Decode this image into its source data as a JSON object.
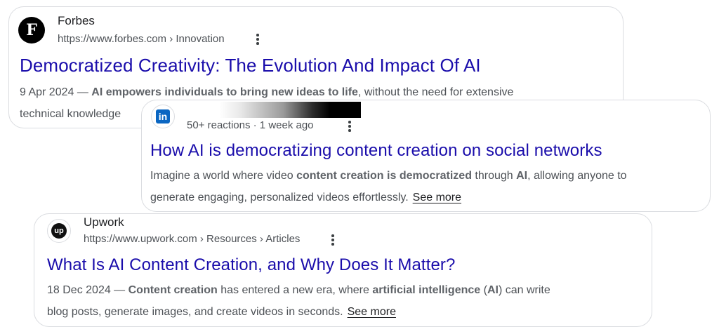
{
  "results": {
    "forbes": {
      "site_name": "Forbes",
      "url": "https://www.forbes.com › Innovation",
      "favicon_letter": "F",
      "title": "Democratized Creativity: The Evolution And Impact Of AI",
      "date": "9 Apr 2024",
      "dash": " — ",
      "snippet_bold": "AI empowers individuals to bring new ideas to life",
      "snippet_rest": ", without the need for extensive",
      "snippet_line2": "technical knowledge"
    },
    "linkedin": {
      "favicon_text": "in",
      "meta": "50+ reactions · 1 week ago",
      "title": "How AI is democratizing content creation on social networks",
      "s1": "Imagine a world where video ",
      "s2": "content creation",
      "s3": " ",
      "s4": "is democratized",
      "s5": " through ",
      "s6": "AI",
      "s7": ", allowing anyone to",
      "s8": "generate engaging, personalized videos effortlessly.",
      "see_more": "See more"
    },
    "upwork": {
      "site_name": "Upwork",
      "url": "https://www.upwork.com › Resources › Articles",
      "favicon_text": "up",
      "title": "What Is AI Content Creation, and Why Does It Matter?",
      "date": "18 Dec 2024",
      "dash": " — ",
      "s1": "Content creation",
      "s2": " has entered a new era, where ",
      "s3": "artificial intelligence",
      "s4": " (",
      "s5": "AI",
      "s6": ") can write",
      "s7": "blog posts, generate images, and create videos in seconds.",
      "see_more": "See more"
    }
  },
  "colors": {
    "title_link": "#1a0dab",
    "text": "#4d5156",
    "border": "#dadce0",
    "linkedin_blue": "#0a66c2"
  },
  "icons": {
    "forbes": "forbes-logo-icon",
    "linkedin": "linkedin-logo-icon",
    "upwork": "upwork-logo-icon",
    "menu": "more-vert-icon"
  }
}
